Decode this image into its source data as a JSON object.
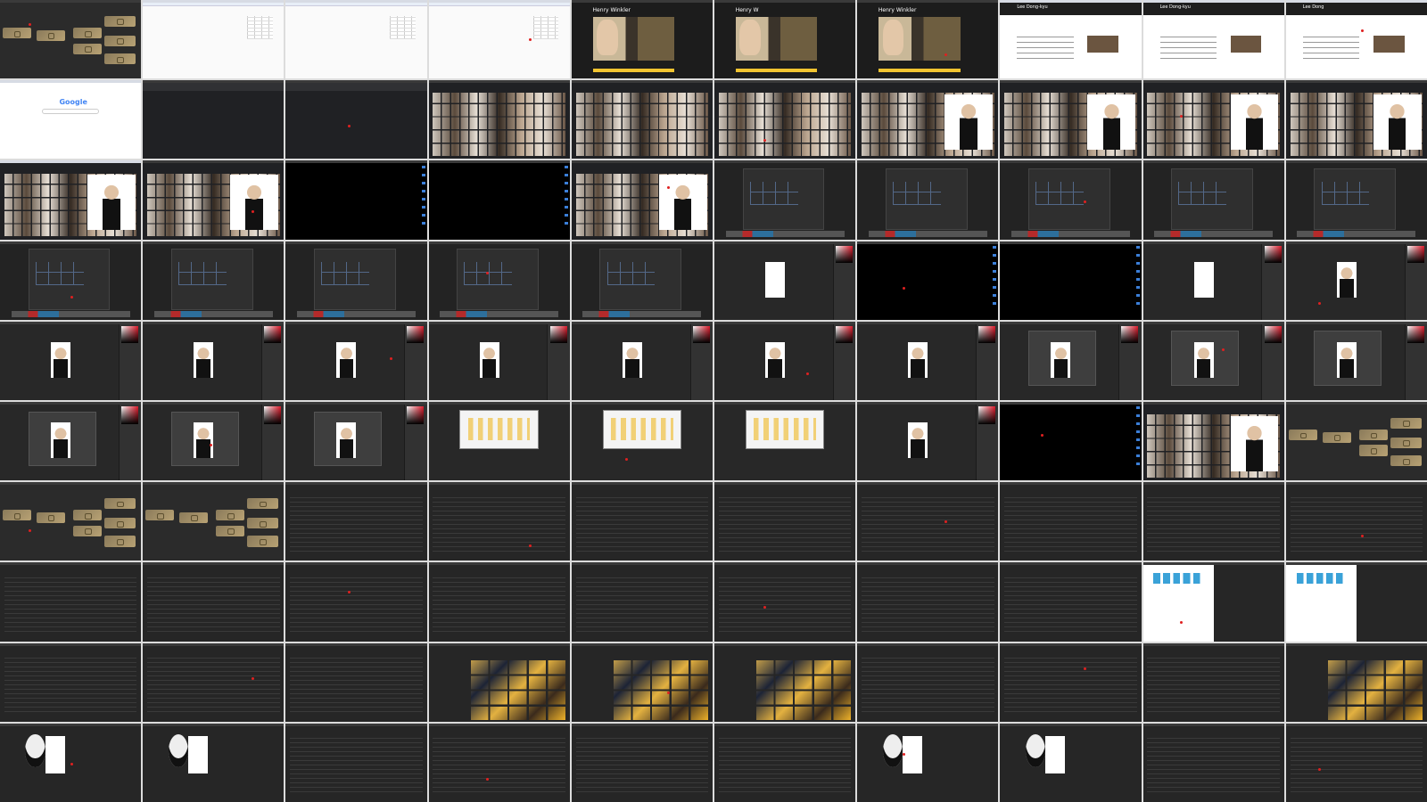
{
  "tiles": [
    {
      "type": "tiles",
      "light": false
    },
    {
      "type": "sheet",
      "light": true
    },
    {
      "type": "sheet",
      "light": true
    },
    {
      "type": "sheet",
      "light": true
    },
    {
      "type": "profile",
      "light": false,
      "name": "Henry Winkler"
    },
    {
      "type": "profile",
      "light": false,
      "name": "Henry W"
    },
    {
      "type": "profile",
      "light": false,
      "name": "Henry Winkler"
    },
    {
      "type": "wiki",
      "light": true,
      "name": "Lee Dong-kyu"
    },
    {
      "type": "wiki",
      "light": true,
      "name": "Lee Dong-kyu"
    },
    {
      "type": "wiki",
      "light": true,
      "name": "Lee Dong"
    },
    {
      "type": "google",
      "light": true,
      "logo": "Google"
    },
    {
      "type": "gdark",
      "light": false
    },
    {
      "type": "gdark",
      "light": false
    },
    {
      "type": "photos",
      "light": false
    },
    {
      "type": "photos",
      "light": false
    },
    {
      "type": "photos",
      "light": false
    },
    {
      "type": "photos",
      "light": false,
      "preview": true
    },
    {
      "type": "photos",
      "light": false,
      "preview": true
    },
    {
      "type": "photos",
      "light": false,
      "preview": true
    },
    {
      "type": "photos",
      "light": false,
      "preview": true
    },
    {
      "type": "photos",
      "light": true,
      "preview": true
    },
    {
      "type": "photos",
      "light": false,
      "preview": true
    },
    {
      "type": "black",
      "light": false
    },
    {
      "type": "black",
      "light": false
    },
    {
      "type": "photos",
      "light": false,
      "preview": true
    },
    {
      "type": "newdoc",
      "light": false
    },
    {
      "type": "newdoc",
      "light": false
    },
    {
      "type": "newdoc",
      "light": false
    },
    {
      "type": "newdoc",
      "light": false
    },
    {
      "type": "newdoc",
      "light": false
    },
    {
      "type": "newdoc",
      "light": false
    },
    {
      "type": "newdoc",
      "light": false
    },
    {
      "type": "newdoc",
      "light": false
    },
    {
      "type": "newdoc",
      "light": false
    },
    {
      "type": "newdoc",
      "light": false
    },
    {
      "type": "ps",
      "light": false,
      "doc": "blank"
    },
    {
      "type": "black",
      "light": false
    },
    {
      "type": "black",
      "light": false
    },
    {
      "type": "ps",
      "light": false,
      "doc": "blank"
    },
    {
      "type": "ps",
      "light": false,
      "doc": "photo"
    },
    {
      "type": "ps",
      "light": false,
      "doc": "photo"
    },
    {
      "type": "ps",
      "light": false,
      "doc": "photo"
    },
    {
      "type": "ps",
      "light": false,
      "doc": "photo"
    },
    {
      "type": "ps",
      "light": false,
      "doc": "photo"
    },
    {
      "type": "ps",
      "light": false,
      "doc": "photo"
    },
    {
      "type": "ps",
      "light": false,
      "doc": "photo"
    },
    {
      "type": "ps",
      "light": false,
      "doc": "photo"
    },
    {
      "type": "ps",
      "light": false,
      "doc": "dialog"
    },
    {
      "type": "ps",
      "light": false,
      "doc": "dialog"
    },
    {
      "type": "ps",
      "light": false,
      "doc": "dialog"
    },
    {
      "type": "ps",
      "light": false,
      "doc": "dialog"
    },
    {
      "type": "ps",
      "light": false,
      "doc": "dialog"
    },
    {
      "type": "ps",
      "light": false,
      "doc": "dialog"
    },
    {
      "type": "explorer",
      "light": false
    },
    {
      "type": "explorer",
      "light": false
    },
    {
      "type": "explorer",
      "light": false
    },
    {
      "type": "ps",
      "light": false,
      "doc": "photo"
    },
    {
      "type": "black",
      "light": false
    },
    {
      "type": "photos",
      "light": false,
      "preview": true
    },
    {
      "type": "tiles",
      "light": false
    },
    {
      "type": "tiles",
      "light": false
    },
    {
      "type": "tiles",
      "light": false
    },
    {
      "type": "list",
      "light": false
    },
    {
      "type": "list",
      "light": false
    },
    {
      "type": "list",
      "light": false
    },
    {
      "type": "list",
      "light": false
    },
    {
      "type": "list",
      "light": false
    },
    {
      "type": "list",
      "light": false
    },
    {
      "type": "list",
      "light": false
    },
    {
      "type": "list",
      "light": false
    },
    {
      "type": "list",
      "light": false
    },
    {
      "type": "list",
      "light": false
    },
    {
      "type": "list",
      "light": false
    },
    {
      "type": "list",
      "light": false
    },
    {
      "type": "list",
      "light": false
    },
    {
      "type": "list",
      "light": false
    },
    {
      "type": "list",
      "light": false
    },
    {
      "type": "list",
      "light": false
    },
    {
      "type": "filewhite",
      "light": false
    },
    {
      "type": "filewhite",
      "light": false
    },
    {
      "type": "list",
      "light": false
    },
    {
      "type": "list",
      "light": false
    },
    {
      "type": "list",
      "light": false
    },
    {
      "type": "gallery",
      "light": false
    },
    {
      "type": "gallery",
      "light": false
    },
    {
      "type": "gallery",
      "light": false
    },
    {
      "type": "list",
      "light": false
    },
    {
      "type": "list",
      "light": false
    },
    {
      "type": "list",
      "light": false
    },
    {
      "type": "gallery",
      "light": false
    },
    {
      "type": "avatar",
      "light": false
    },
    {
      "type": "avatar",
      "light": false
    },
    {
      "type": "list",
      "light": false
    },
    {
      "type": "list",
      "light": false
    },
    {
      "type": "list",
      "light": false
    },
    {
      "type": "list",
      "light": false
    },
    {
      "type": "avatar",
      "light": false
    },
    {
      "type": "avatar",
      "light": false
    },
    {
      "type": "list",
      "light": false
    },
    {
      "type": "list",
      "light": false
    }
  ],
  "colors": {
    "accent": "#f2c430",
    "marker": "#e02020",
    "dark_bg": "#2b2b2b"
  }
}
